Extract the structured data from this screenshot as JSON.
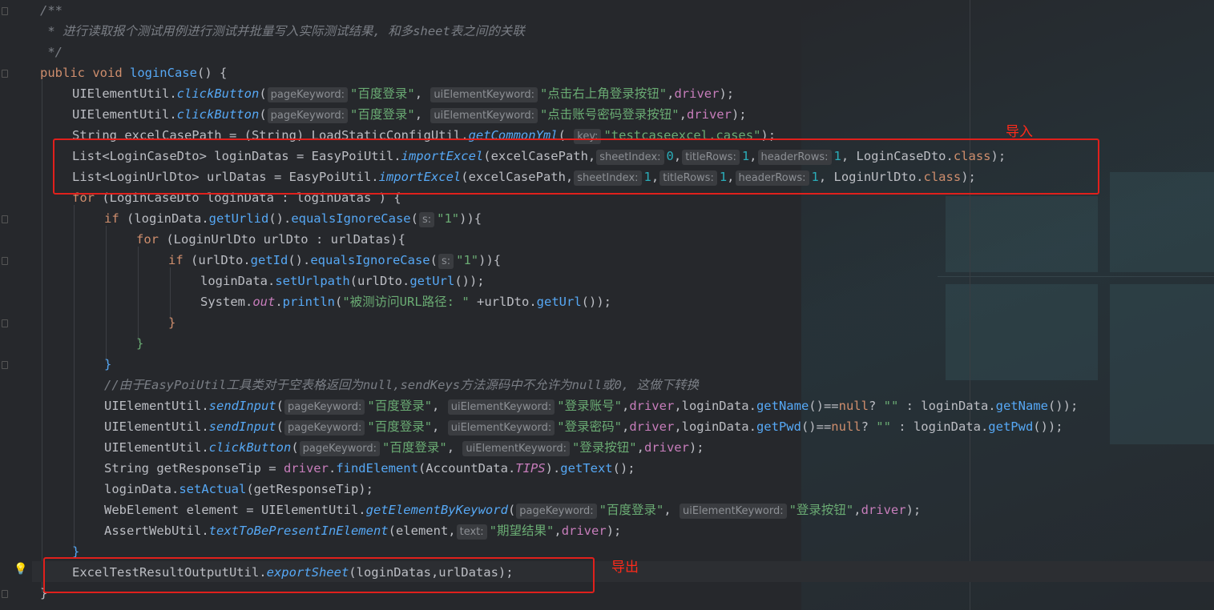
{
  "editor": {
    "lines": [
      {
        "indent": 0,
        "segs": [
          {
            "c": "cm",
            "t": "/**"
          }
        ]
      },
      {
        "indent": 0,
        "segs": [
          {
            "c": "cm",
            "t": " * 进行读取报个测试用例进行测试并批量写入实际测试结果, 和多sheet表之间的关联"
          }
        ]
      },
      {
        "indent": 0,
        "segs": [
          {
            "c": "cm",
            "t": " */"
          }
        ]
      },
      {
        "indent": 0,
        "segs": [
          {
            "c": "kw",
            "t": "public void "
          },
          {
            "c": "fn",
            "t": "loginCase"
          },
          {
            "c": "",
            "t": "() {"
          }
        ]
      },
      {
        "indent": 1,
        "segs": [
          {
            "c": "cn",
            "t": "UIElementUtil."
          },
          {
            "c": "sfn",
            "t": "clickButton"
          },
          {
            "c": "",
            "t": "("
          },
          {
            "c": "hint",
            "t": "pageKeyword:"
          },
          {
            "c": "st",
            "t": "\"百度登录\""
          },
          {
            "c": "",
            "t": ", "
          },
          {
            "c": "hint",
            "t": "uiElementKeyword:"
          },
          {
            "c": "st",
            "t": "\"点击右上角登录按钮\""
          },
          {
            "c": "",
            "t": ","
          },
          {
            "c": "pm",
            "t": "driver"
          },
          {
            "c": "",
            "t": ");"
          }
        ]
      },
      {
        "indent": 1,
        "segs": [
          {
            "c": "cn",
            "t": "UIElementUtil."
          },
          {
            "c": "sfn",
            "t": "clickButton"
          },
          {
            "c": "",
            "t": "("
          },
          {
            "c": "hint",
            "t": "pageKeyword:"
          },
          {
            "c": "st",
            "t": "\"百度登录\""
          },
          {
            "c": "",
            "t": ", "
          },
          {
            "c": "hint",
            "t": "uiElementKeyword:"
          },
          {
            "c": "st",
            "t": "\"点击账号密码登录按钮\""
          },
          {
            "c": "",
            "t": ","
          },
          {
            "c": "pm",
            "t": "driver"
          },
          {
            "c": "",
            "t": ");"
          }
        ]
      },
      {
        "indent": 1,
        "segs": [
          {
            "c": "",
            "t": "String excelCasePath = (String) LoadStaticConfigUtil."
          },
          {
            "c": "sfn",
            "t": "getCommonYml"
          },
          {
            "c": "",
            "t": "( "
          },
          {
            "c": "hint",
            "t": "key:"
          },
          {
            "c": "st",
            "t": "\"testcaseexcel.cases\""
          },
          {
            "c": "",
            "t": ");"
          }
        ]
      },
      {
        "indent": 1,
        "segs": [
          {
            "c": "",
            "t": "List<LoginCaseDto> loginDatas = EasyPoiUtil."
          },
          {
            "c": "sfn",
            "t": "importExcel"
          },
          {
            "c": "",
            "t": "(excelCasePath,"
          },
          {
            "c": "hint",
            "t": "sheetIndex:"
          },
          {
            "c": "nm",
            "t": "0"
          },
          {
            "c": "",
            "t": ","
          },
          {
            "c": "hint",
            "t": "titleRows:"
          },
          {
            "c": "nm",
            "t": "1"
          },
          {
            "c": "",
            "t": ","
          },
          {
            "c": "hint",
            "t": "headerRows:"
          },
          {
            "c": "nm",
            "t": "1"
          },
          {
            "c": "",
            "t": ", LoginCaseDto."
          },
          {
            "c": "kw",
            "t": "class"
          },
          {
            "c": "",
            "t": ");"
          }
        ]
      },
      {
        "indent": 1,
        "segs": [
          {
            "c": "",
            "t": "List<LoginUrlDto> urlDatas = EasyPoiUtil."
          },
          {
            "c": "sfn",
            "t": "importExcel"
          },
          {
            "c": "",
            "t": "(excelCasePath,"
          },
          {
            "c": "hint",
            "t": "sheetIndex:"
          },
          {
            "c": "nm",
            "t": "1"
          },
          {
            "c": "",
            "t": ","
          },
          {
            "c": "hint",
            "t": "titleRows:"
          },
          {
            "c": "nm",
            "t": "1"
          },
          {
            "c": "",
            "t": ","
          },
          {
            "c": "hint",
            "t": "headerRows:"
          },
          {
            "c": "nm",
            "t": "1"
          },
          {
            "c": "",
            "t": ", LoginUrlDto."
          },
          {
            "c": "kw",
            "t": "class"
          },
          {
            "c": "",
            "t": ");"
          }
        ]
      },
      {
        "indent": 1,
        "segs": [
          {
            "c": "kw",
            "t": "for "
          },
          {
            "c": "",
            "t": "(LoginCaseDto loginData : loginDatas ) {"
          }
        ]
      },
      {
        "indent": 2,
        "segs": [
          {
            "c": "kw",
            "t": "if "
          },
          {
            "c": "",
            "t": "(loginData."
          },
          {
            "c": "fn",
            "t": "getUrlid"
          },
          {
            "c": "",
            "t": "()."
          },
          {
            "c": "fn",
            "t": "equalsIgnoreCase"
          },
          {
            "c": "",
            "t": "("
          },
          {
            "c": "hint",
            "t": "s:"
          },
          {
            "c": "st",
            "t": "\"1\""
          },
          {
            "c": "",
            "t": ")){"
          }
        ]
      },
      {
        "indent": 3,
        "segs": [
          {
            "c": "kw",
            "t": "for "
          },
          {
            "c": "",
            "t": "(LoginUrlDto urlDto : urlDatas){"
          }
        ]
      },
      {
        "indent": 4,
        "segs": [
          {
            "c": "kw",
            "t": "if "
          },
          {
            "c": "",
            "t": "(urlDto."
          },
          {
            "c": "fn",
            "t": "getId"
          },
          {
            "c": "",
            "t": "()."
          },
          {
            "c": "fn",
            "t": "equalsIgnoreCase"
          },
          {
            "c": "",
            "t": "("
          },
          {
            "c": "hint",
            "t": "s:"
          },
          {
            "c": "st",
            "t": "\"1\""
          },
          {
            "c": "",
            "t": ")){"
          }
        ]
      },
      {
        "indent": 5,
        "segs": [
          {
            "c": "",
            "t": "loginData."
          },
          {
            "c": "fn",
            "t": "setUrlpath"
          },
          {
            "c": "",
            "t": "(urlDto."
          },
          {
            "c": "fn",
            "t": "getUrl"
          },
          {
            "c": "",
            "t": "());"
          }
        ]
      },
      {
        "indent": 5,
        "segs": [
          {
            "c": "",
            "t": "System."
          },
          {
            "c": "fd",
            "t": "out"
          },
          {
            "c": "",
            "t": "."
          },
          {
            "c": "fn",
            "t": "println"
          },
          {
            "c": "",
            "t": "("
          },
          {
            "c": "st",
            "t": "\"被测访问URL路径: \""
          },
          {
            "c": "",
            "t": " +urlDto."
          },
          {
            "c": "fn",
            "t": "getUrl"
          },
          {
            "c": "",
            "t": "());"
          }
        ]
      },
      {
        "indent": 4,
        "segs": [
          {
            "c": "kw",
            "t": "}"
          }
        ]
      },
      {
        "indent": 3,
        "segs": [
          {
            "c": "st",
            "t": "}"
          }
        ]
      },
      {
        "indent": 2,
        "segs": [
          {
            "c": "fn",
            "t": "}"
          }
        ]
      },
      {
        "indent": 2,
        "segs": [
          {
            "c": "cm",
            "t": "//由于EasyPoiUtil工具类对于空表格返回为null,sendKeys方法源码中不允许为null或0, 这做下转换"
          }
        ]
      },
      {
        "indent": 2,
        "segs": [
          {
            "c": "cn",
            "t": "UIElementUtil."
          },
          {
            "c": "sfn",
            "t": "sendInput"
          },
          {
            "c": "",
            "t": "("
          },
          {
            "c": "hint",
            "t": "pageKeyword:"
          },
          {
            "c": "st",
            "t": "\"百度登录\""
          },
          {
            "c": "",
            "t": ", "
          },
          {
            "c": "hint",
            "t": "uiElementKeyword:"
          },
          {
            "c": "st",
            "t": "\"登录账号\""
          },
          {
            "c": "",
            "t": ","
          },
          {
            "c": "pm",
            "t": "driver"
          },
          {
            "c": "",
            "t": ",loginData."
          },
          {
            "c": "fn",
            "t": "getName"
          },
          {
            "c": "",
            "t": "()=="
          },
          {
            "c": "kw",
            "t": "null"
          },
          {
            "c": "",
            "t": "? "
          },
          {
            "c": "st",
            "t": "\"\""
          },
          {
            "c": "",
            "t": " : loginData."
          },
          {
            "c": "fn",
            "t": "getName"
          },
          {
            "c": "",
            "t": "());"
          }
        ]
      },
      {
        "indent": 2,
        "segs": [
          {
            "c": "cn",
            "t": "UIElementUtil."
          },
          {
            "c": "sfn",
            "t": "sendInput"
          },
          {
            "c": "",
            "t": "("
          },
          {
            "c": "hint",
            "t": "pageKeyword:"
          },
          {
            "c": "st",
            "t": "\"百度登录\""
          },
          {
            "c": "",
            "t": ", "
          },
          {
            "c": "hint",
            "t": "uiElementKeyword:"
          },
          {
            "c": "st",
            "t": "\"登录密码\""
          },
          {
            "c": "",
            "t": ","
          },
          {
            "c": "pm",
            "t": "driver"
          },
          {
            "c": "",
            "t": ",loginData."
          },
          {
            "c": "fn",
            "t": "getPwd"
          },
          {
            "c": "",
            "t": "()=="
          },
          {
            "c": "kw",
            "t": "null"
          },
          {
            "c": "",
            "t": "? "
          },
          {
            "c": "st",
            "t": "\"\""
          },
          {
            "c": "",
            "t": " : loginData."
          },
          {
            "c": "fn",
            "t": "getPwd"
          },
          {
            "c": "",
            "t": "());"
          }
        ]
      },
      {
        "indent": 2,
        "segs": [
          {
            "c": "cn",
            "t": "UIElementUtil."
          },
          {
            "c": "sfn",
            "t": "clickButton"
          },
          {
            "c": "",
            "t": "("
          },
          {
            "c": "hint",
            "t": "pageKeyword:"
          },
          {
            "c": "st",
            "t": "\"百度登录\""
          },
          {
            "c": "",
            "t": ", "
          },
          {
            "c": "hint",
            "t": "uiElementKeyword:"
          },
          {
            "c": "st",
            "t": "\"登录按钮\""
          },
          {
            "c": "",
            "t": ","
          },
          {
            "c": "pm",
            "t": "driver"
          },
          {
            "c": "",
            "t": ");"
          }
        ]
      },
      {
        "indent": 2,
        "segs": [
          {
            "c": "",
            "t": "String getResponseTip = "
          },
          {
            "c": "pm",
            "t": "driver"
          },
          {
            "c": "",
            "t": "."
          },
          {
            "c": "fn",
            "t": "findElement"
          },
          {
            "c": "",
            "t": "(AccountData."
          },
          {
            "c": "fd",
            "t": "TIPS"
          },
          {
            "c": "",
            "t": ")."
          },
          {
            "c": "fn",
            "t": "getText"
          },
          {
            "c": "",
            "t": "();"
          }
        ]
      },
      {
        "indent": 2,
        "segs": [
          {
            "c": "",
            "t": "loginData."
          },
          {
            "c": "fn",
            "t": "setActual"
          },
          {
            "c": "",
            "t": "(getResponseTip);"
          }
        ]
      },
      {
        "indent": 2,
        "segs": [
          {
            "c": "",
            "t": "WebElement element = UIElementUtil."
          },
          {
            "c": "sfn",
            "t": "getElementByKeyword"
          },
          {
            "c": "",
            "t": "("
          },
          {
            "c": "hint",
            "t": "pageKeyword:"
          },
          {
            "c": "st",
            "t": "\"百度登录\""
          },
          {
            "c": "",
            "t": ", "
          },
          {
            "c": "hint",
            "t": "uiElementKeyword:"
          },
          {
            "c": "st",
            "t": "\"登录按钮\""
          },
          {
            "c": "",
            "t": ","
          },
          {
            "c": "pm",
            "t": "driver"
          },
          {
            "c": "",
            "t": ");"
          }
        ]
      },
      {
        "indent": 2,
        "segs": [
          {
            "c": "",
            "t": "AssertWebUtil."
          },
          {
            "c": "sfn",
            "t": "textToBePresentInElement"
          },
          {
            "c": "",
            "t": "(element,"
          },
          {
            "c": "hint",
            "t": "text:"
          },
          {
            "c": "st",
            "t": "\"期望结果\""
          },
          {
            "c": "",
            "t": ","
          },
          {
            "c": "pm",
            "t": "driver"
          },
          {
            "c": "",
            "t": ");"
          }
        ]
      },
      {
        "indent": 1,
        "segs": [
          {
            "c": "fn",
            "t": "}"
          }
        ]
      },
      {
        "indent": 1,
        "segs": [
          {
            "c": "",
            "t": "ExcelTestResultOutputUtil."
          },
          {
            "c": "sfn",
            "t": "exportSheet"
          },
          {
            "c": "",
            "t": "(loginDatas,urlDatas);"
          }
        ]
      },
      {
        "indent": 0,
        "segs": [
          {
            "c": "",
            "t": "}"
          }
        ]
      }
    ]
  },
  "annotations": {
    "import_label": "导入",
    "export_label": "导出"
  },
  "colors": {
    "background": "#26282c",
    "keyword": "#cf8e6d",
    "method": "#56a8f5",
    "string": "#6aab73",
    "number": "#2aacb8",
    "field": "#c77dbb",
    "comment": "#7a7e85",
    "annotation_red": "#e0201c"
  },
  "icons": {
    "gutter_hint": "lightbulb-icon"
  }
}
